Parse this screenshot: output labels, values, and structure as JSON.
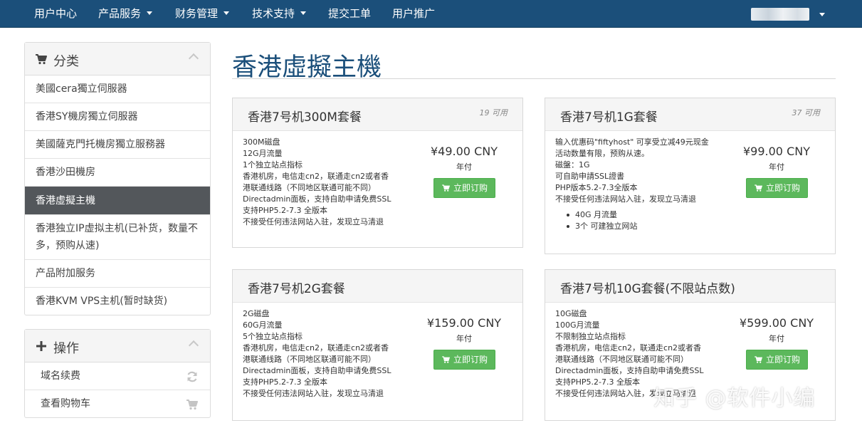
{
  "nav": {
    "items": [
      {
        "label": "用户中心",
        "dropdown": false
      },
      {
        "label": "产品服务",
        "dropdown": true
      },
      {
        "label": "财务管理",
        "dropdown": true
      },
      {
        "label": "技术支持",
        "dropdown": true
      },
      {
        "label": "提交工单",
        "dropdown": false
      },
      {
        "label": "用户推广",
        "dropdown": false
      }
    ]
  },
  "sidebar": {
    "categories": {
      "title": "分类",
      "icon": "cart-icon",
      "items": [
        {
          "label": "美國cera獨立伺服器",
          "active": false
        },
        {
          "label": "香港SY機房獨立伺服器",
          "active": false
        },
        {
          "label": "美國薩克門托機房獨立服務器",
          "active": false
        },
        {
          "label": "香港沙田機房",
          "active": false
        },
        {
          "label": "香港虛擬主機",
          "active": true
        },
        {
          "label": "香港独立IP虚拟主机(已补货，数量不多，预购从速)",
          "active": false
        },
        {
          "label": "产品附加服务",
          "active": false
        },
        {
          "label": "香港KVM VPS主机(暂时缺货)",
          "active": false
        }
      ]
    },
    "actions": {
      "title": "操作",
      "icon": "plus-icon",
      "items": [
        {
          "label": "域名续费",
          "icon": "refresh-icon"
        },
        {
          "label": "查看购物车",
          "icon": "cart-icon"
        }
      ]
    }
  },
  "page": {
    "title": "香港虛擬主機"
  },
  "products": [
    {
      "name": "香港7号机300M套餐",
      "availability": "19 可用",
      "features": [
        "300M磁盘",
        "12G月流量",
        "1个独立站点指标",
        "香港机房，电信走cn2，联通走cn2或者香",
        "港联通线路（不同地区联通可能不同）",
        "Directadmin面板，支持自助申请免费SSL",
        "支持PHP5.2-7.3 全版本",
        "不接受任何违法网站入驻，发现立马清退"
      ],
      "bullets": [],
      "price": "¥49.00 CNY",
      "cycle": "年付",
      "order_label": "立即订购"
    },
    {
      "name": "香港7号机1G套餐",
      "availability": "37 可用",
      "features": [
        "输入优惠码\"fiftyhost\" 可享受立减49元现金",
        "活动数量有限，预购从速。",
        "磁盤：1G",
        "可自助申請SSL證書",
        "PHP版本5.2-7.3全版本",
        "不接受任何违法网站入驻，发现立马清退"
      ],
      "bullets": [
        "40G 月流量",
        "3个 可建独立网站"
      ],
      "price": "¥99.00 CNY",
      "cycle": "年付",
      "order_label": "立即订购"
    },
    {
      "name": "香港7号机2G套餐",
      "availability": "",
      "features": [
        "2G磁盘",
        "60G月流量",
        "5个独立站点指标",
        "香港机房，电信走cn2，联通走cn2或者香",
        "港联通线路（不同地区联通可能不同）",
        "Directadmin面板，支持自助申请免费SSL",
        "支持PHP5.2-7.3 全版本",
        "不接受任何违法网站入驻，发现立马清退"
      ],
      "bullets": [],
      "price": "¥159.00 CNY",
      "cycle": "年付",
      "order_label": "立即订购"
    },
    {
      "name": "香港7号机10G套餐(不限站点数)",
      "availability": "",
      "features": [
        "10G磁盘",
        "100G月流量",
        "不限制独立站点指标",
        "香港机房，电信走cn2，联通走cn2或者香",
        "港联通线路（不同地区联通可能不同）",
        "Directadmin面板，支持自助申请免费SSL",
        "支持PHP5.2-7.3 全版本",
        "不接受任何违法网站入驻，发现立马清退"
      ],
      "bullets": [],
      "price": "¥599.00 CNY",
      "cycle": "年付",
      "order_label": "立即订购"
    }
  ],
  "watermark": "知乎 @软件小编",
  "colors": {
    "navbar": "#1b4f7a",
    "accent": "#1b4f7a",
    "order_button": "#5cb85c",
    "active_item": "#53575b"
  }
}
